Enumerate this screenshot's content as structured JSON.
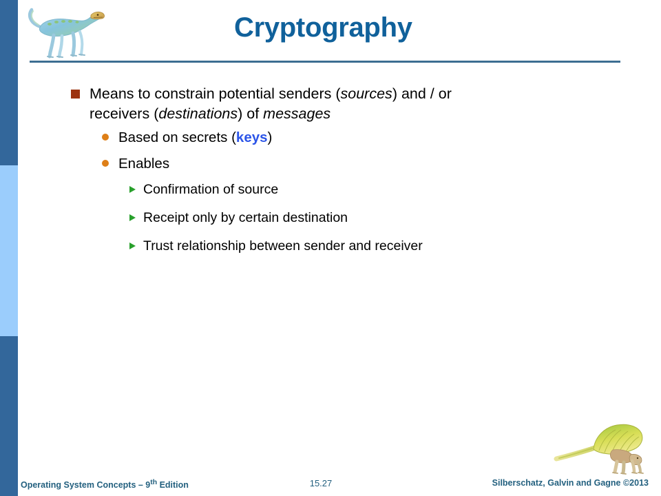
{
  "slide": {
    "title": "Cryptography",
    "accent_color": "#10619B",
    "sidebar": {
      "top_color": "#33679B",
      "middle_color": "#9BCDFC",
      "bottom_color": "#33679B"
    }
  },
  "bullets": {
    "b1": {
      "level": 1,
      "marker": "square-bullet",
      "marker_color": "#9C3310",
      "part1": "Means to constrain potential senders (",
      "em1": "sources",
      "part2": ") and / or receivers (",
      "em2": "destinations",
      "part3": ") of ",
      "em3": "messages"
    },
    "b2": {
      "level": 2,
      "marker": "circle-bullet",
      "marker_color": "#DE7F17",
      "part1": "Based on secrets (",
      "keyword": "keys",
      "keyword_color": "#2C55E8",
      "part2": ")"
    },
    "b3": {
      "level": 2,
      "marker": "circle-bullet",
      "marker_color": "#DE7F17",
      "text": "Enables"
    },
    "b4": {
      "level": 3,
      "marker": "triangle-bullet",
      "marker_color": "#29A02C",
      "text": "Confirmation of source"
    },
    "b5": {
      "level": 3,
      "marker": "triangle-bullet",
      "marker_color": "#29A02C",
      "text": "Receipt only by certain destination"
    },
    "b6": {
      "level": 3,
      "marker": "triangle-bullet",
      "marker_color": "#29A02C",
      "text": "Trust relationship between sender and receiver"
    }
  },
  "footer": {
    "book_title": "Operating System Concepts ",
    "edition_dash": "– 9",
    "edition_sup": "th",
    "edition_suffix": " Edition",
    "page_number": "15.27",
    "copyright": "Silberschatz, Galvin and Gagne ©2013",
    "text_color": "#23607F"
  },
  "images": {
    "header_dinosaur": "dinosaur-illustration-blue-green",
    "footer_dinosaur": "dinosaur-illustration-sailback-yellow-green"
  }
}
